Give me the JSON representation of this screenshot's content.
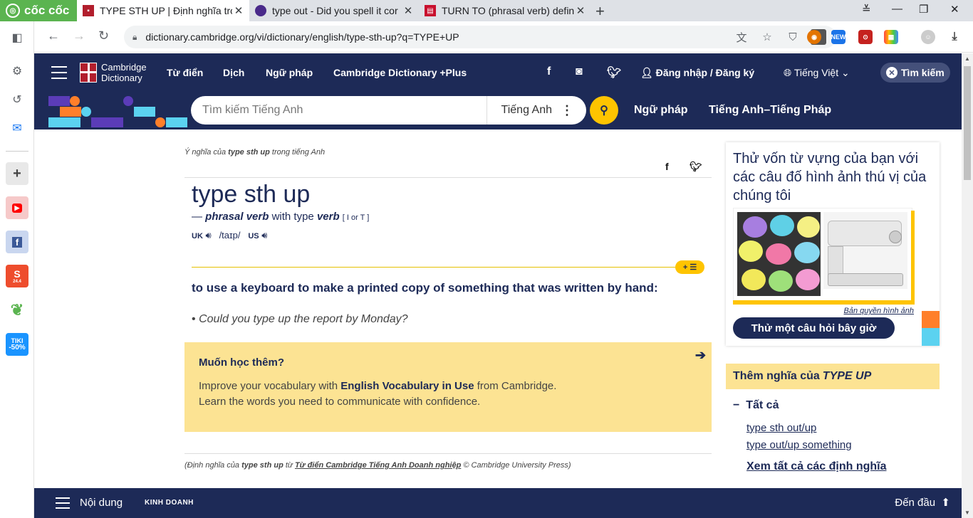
{
  "browser": {
    "brand": "cốc cốc",
    "tabs": [
      {
        "title": "TYPE STH UP | Định nghĩa tro",
        "favicon_color": "#b21e2d"
      },
      {
        "title": "type out - Did you spell it cor",
        "favicon_color": "#4a2a8a"
      },
      {
        "title": "TURN TO (phrasal verb) defini",
        "favicon_color": "#c8102e"
      }
    ],
    "new_tab": "+",
    "url": "dictionary.cambridge.org/vi/dictionary/english/type-sth-up?q=TYPE+UP",
    "ext_new_badge": "NEW"
  },
  "sidebar": {
    "shopee_badge": "24.4",
    "tiki_label": "TIKI",
    "tiki_badge": "-50%"
  },
  "site": {
    "logo_line1": "Cambridge",
    "logo_line2": "Dictionary",
    "nav": [
      "Từ điển",
      "Dịch",
      "Ngữ pháp",
      "Cambridge Dictionary +Plus"
    ],
    "login": "Đăng nhập / Đăng ký",
    "language": "Tiếng Việt",
    "search_pill": "Tìm kiếm",
    "search_placeholder": "Tìm kiếm Tiếng Anh",
    "search_lang": "Tiếng Anh",
    "search_links": [
      "Ngữ pháp",
      "Tiếng Anh–Tiếng Pháp"
    ]
  },
  "entry": {
    "crumb_prefix": "Ý nghĩa của",
    "crumb_word": "type sth up",
    "crumb_suffix": "trong tiếng Anh",
    "headword": "type sth up",
    "pos_dash": "—",
    "pos_label": "phrasal verb",
    "pos_with": "with type",
    "pos_verb": "verb",
    "pos_grammar": "[ I or T ]",
    "uk": "UK",
    "ipa": "/taɪp/",
    "us": "US",
    "definition": "to use a keyboard to make a printed copy of something that was written by hand:",
    "example": "Could you type up the report by Monday?",
    "learn_title": "Muốn học thêm?",
    "learn_text_1": "Improve your vocabulary with",
    "learn_text_bold": "English Vocabulary in Use",
    "learn_text_2": "from Cambridge.",
    "learn_text_3": "Learn the words you need to communicate with confidence.",
    "source_prefix": "(Định nghĩa của",
    "source_word": "type sth up",
    "source_from": "từ",
    "source_dict": "Từ điển Cambridge Tiếng Anh Doanh nghiệp",
    "source_suffix": "© Cambridge University Press)"
  },
  "right": {
    "quiz_title": "Thử vốn từ vựng của bạn với các câu đố hình ảnh thú vị của chúng tôi",
    "copyright": "Bản quyền hình ảnh",
    "quiz_button": "Thử một câu hỏi bây giờ",
    "more_prefix": "Thêm nghĩa của",
    "more_word": "TYPE UP",
    "all_label": "Tất cả",
    "links": [
      "type sth out/up",
      "type out/up something"
    ],
    "see_all": "Xem tất cả các định nghĩa"
  },
  "bottom": {
    "contents": "Nội dung",
    "section": "KINH DOANH",
    "to_top": "Đến đầu"
  },
  "colors": {
    "navy": "#1d2a57",
    "yellow": "#fec400",
    "pale_yellow": "#fce393",
    "orange": "#ff7f2a",
    "cyan": "#5bd2f0",
    "purple": "#5b3cb8"
  }
}
